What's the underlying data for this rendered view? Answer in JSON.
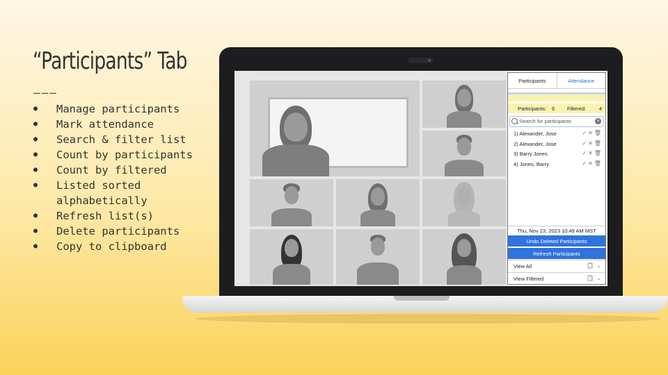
{
  "slide": {
    "title": "“Participants” Tab",
    "rule": "———",
    "bullets": [
      "Manage participants",
      "Mark attendance",
      "Search & filter list",
      "Count by participants",
      "Count by filtered",
      "Listed sorted alphabetically",
      "Refresh list(s)",
      "Delete participants",
      "Copy to clipboard"
    ]
  },
  "panel": {
    "tabs": [
      "Participants",
      "Attendance"
    ],
    "counts": {
      "participants_label": "Participants:",
      "participants_value": "6",
      "filtered_label": "Filtered:",
      "filtered_value": "4"
    },
    "search": {
      "placeholder": "Search for participants"
    },
    "participants": [
      "1) Alexander, Jose",
      "2) Alexander, Jose",
      "3) Barry Jones",
      "4) Jones, Barry"
    ],
    "datetime": "Thu, Nov 23, 2023 10:49 AM MST",
    "buttons": {
      "undo": "Undo Deleted Participants",
      "refresh": "Refresh Participants"
    },
    "views": [
      "View All",
      "View Filtered"
    ],
    "icons": {
      "check": "check-icon",
      "remove": "x-icon",
      "delete": "trash-icon",
      "copy": "clipboard-icon",
      "expand": "chevron-down-icon",
      "search": "search-icon",
      "clear": "clear-icon"
    },
    "colors": {
      "accent": "#2f73dc",
      "highlight": "#fbf2b0"
    }
  }
}
